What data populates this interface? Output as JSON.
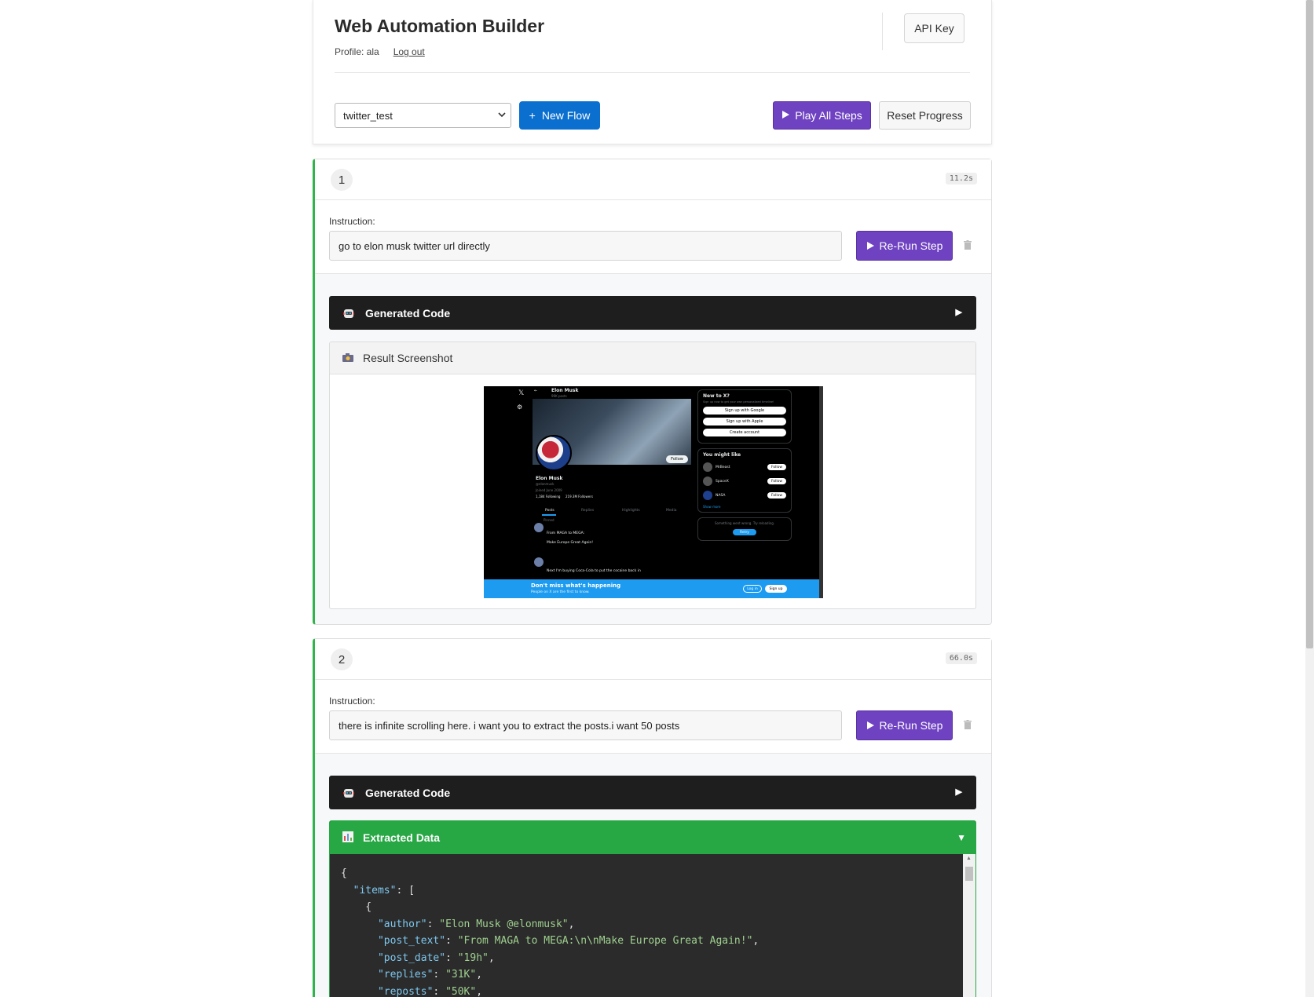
{
  "header": {
    "title": "Web Automation Builder",
    "profile": "Profile: ala",
    "logout": "Log out",
    "api_key": "API Key",
    "flow_selected": "twitter_test",
    "new_flow": "New Flow",
    "play_all": "Play All Steps",
    "reset": "Reset Progress"
  },
  "steps": [
    {
      "number": "1",
      "time": "11.2s",
      "instruction_label": "Instruction:",
      "instruction": "go to elon musk twitter url directly",
      "rerun": "Re-Run Step",
      "code_label": "Generated Code",
      "result_label": "Result Screenshot",
      "screenshot": {
        "profile_name": "Elon Musk",
        "posts_count": "99K posts",
        "handle": "@elonmusk",
        "joined": "Joined June 2009",
        "following": "1,184 Following",
        "followers": "219.3M Followers",
        "tabs": [
          "Posts",
          "Replies",
          "Highlights",
          "Media"
        ],
        "pinned": "Pinned",
        "post1": "From MAGA to MEGA:",
        "post1b": "Make Europe Great Again!",
        "post2": "Next I'm buying Coca-Cola to put the cocaine back in",
        "follow": "Follow",
        "new_to_x": "New to X?",
        "signup_hint": "Sign up now to get your own personalized timeline!",
        "google": "Sign up with Google",
        "apple": "Sign up with Apple",
        "create": "Create account",
        "you_might_like": "You might like",
        "suggestions": [
          "MrBeast",
          "SpaceX",
          "NASA"
        ],
        "show_more": "Show more",
        "error": "Something went wrong. Try reloading.",
        "retry": "Retry",
        "banner_title": "Don't miss what's happening",
        "banner_sub": "People on X are the first to know.",
        "login": "Log in",
        "signup": "Sign up"
      }
    },
    {
      "number": "2",
      "time": "66.0s",
      "instruction_label": "Instruction:",
      "instruction": "there is infinite scrolling here. i want you to extract the posts.i want 50 posts",
      "rerun": "Re-Run Step",
      "code_label": "Generated Code",
      "data_label": "Extracted Data",
      "json_items": {
        "author": "\"Elon Musk @elonmusk\"",
        "post_text": "\"From MAGA to MEGA:\\n\\nMake Europe Great Again!\"",
        "post_date": "\"19h\"",
        "replies": "\"31K\"",
        "reposts": "\"50K\""
      }
    }
  ],
  "colors": {
    "primary_blue": "#0b6fcf",
    "purple": "#6f42c1",
    "success_green": "#28a745",
    "code_bar": "#1e1e1e"
  }
}
